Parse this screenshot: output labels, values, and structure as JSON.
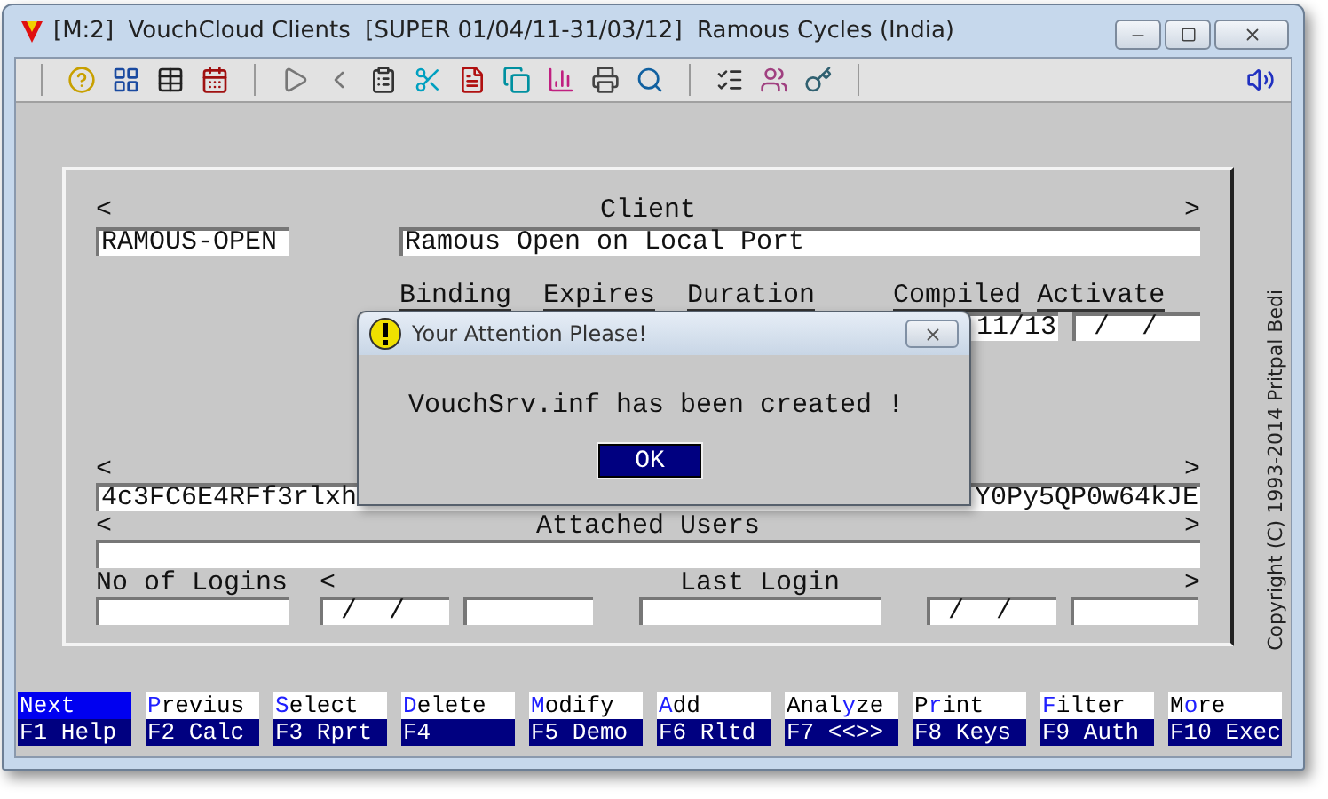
{
  "window": {
    "title": "[M:2]  VouchCloud Clients  [SUPER 01/04/11-31/03/12]  Ramous Cycles (India)"
  },
  "form": {
    "client_row": {
      "left_arrow": "<",
      "label": "Client",
      "right_arrow": ">"
    },
    "client_code": "RAMOUS-OPEN",
    "client_name": "Ramous Open on Local Port",
    "headers": [
      "Binding",
      "Expires",
      "Duration",
      "Compiled",
      "Activate"
    ],
    "compiled_value": "11/13",
    "activate_value": " /  /",
    "key_row": {
      "left_arrow": "<",
      "right_arrow": ">"
    },
    "key_left": "4c3FC6E4RFf3rlxh",
    "key_right": "Y0Py5QP0w64kJE",
    "users_row": {
      "left_arrow": "<",
      "label": "Attached Users",
      "right_arrow": ">"
    },
    "logins_label": "No of Logins",
    "last_login_row": {
      "left_arrow": "<",
      "label": "Last Login",
      "right_arrow": ">"
    },
    "date_1": " /  /",
    "date_2": " /  /"
  },
  "dialog": {
    "title": "Your Attention Please!",
    "message": "VouchSrv.inf has been created !",
    "button": "OK"
  },
  "copyright": "Copyright (C) 1993-2014 Pritpal Bedi",
  "function_keys": [
    {
      "key": "N",
      "post": "ext",
      "selected": true,
      "fn": "F1 Help"
    },
    {
      "key": "P",
      "post": "revius",
      "selected": false,
      "fn": "F2 Calc"
    },
    {
      "key": "S",
      "post": "elect",
      "selected": false,
      "fn": "F3 Rprt"
    },
    {
      "key": "D",
      "post": "elete",
      "selected": false,
      "fn": "F4"
    },
    {
      "key": "M",
      "post": "odify",
      "selected": false,
      "fn": "F5 Demo"
    },
    {
      "key": "A",
      "post": "dd",
      "selected": false,
      "fn": "F6 Rltd"
    },
    {
      "pre": "Anal",
      "key": "y",
      "post": "ze",
      "selected": false,
      "fn": "F7 <<>>"
    },
    {
      "pre": "P",
      "key": "r",
      "post": "int",
      "selected": false,
      "fn": "F8 Keys"
    },
    {
      "key": "F",
      "post": "ilter",
      "selected": false,
      "fn": "F9 Auth"
    },
    {
      "pre": "M",
      "key": "o",
      "post": "re",
      "selected": false,
      "fn": "F10 Exec"
    }
  ]
}
